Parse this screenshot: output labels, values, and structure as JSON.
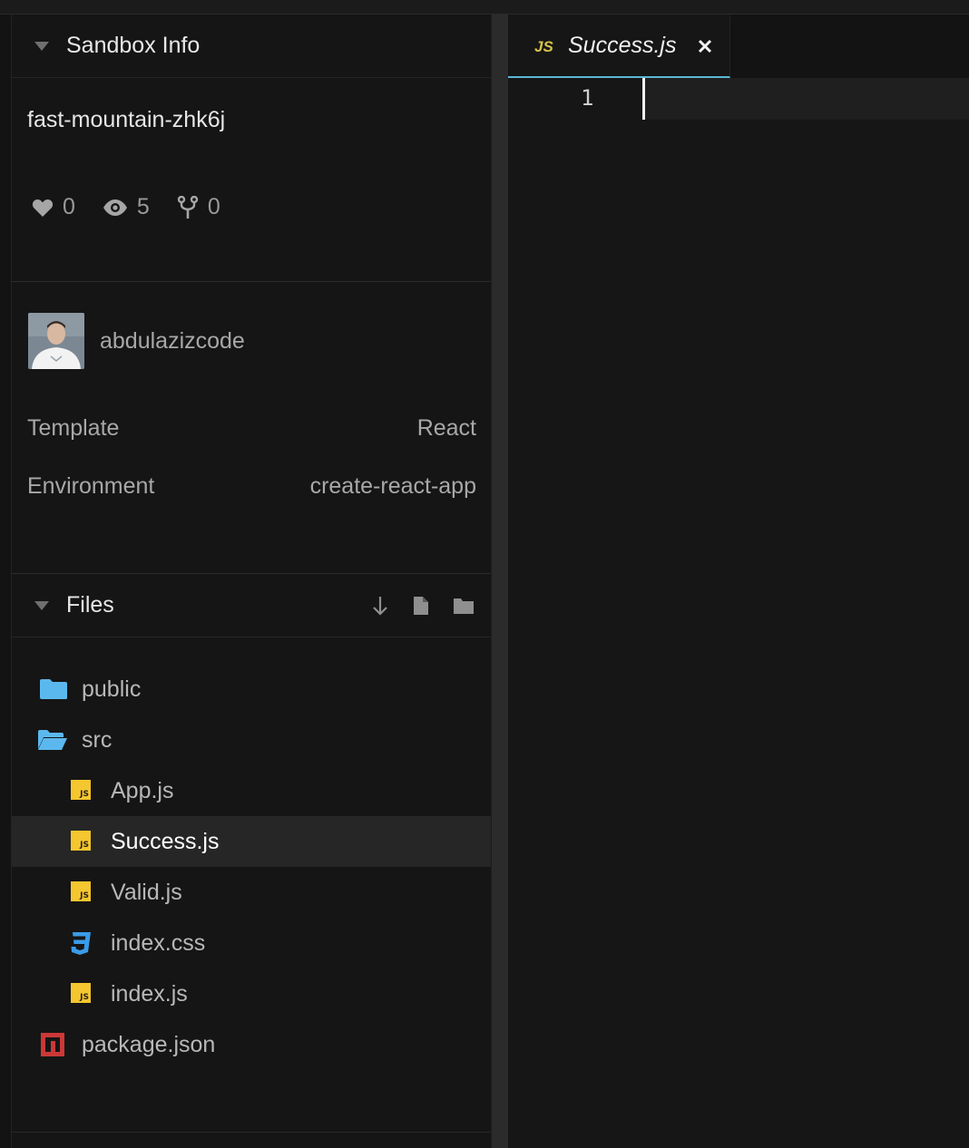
{
  "sidebar": {
    "sandbox_info": {
      "title": "Sandbox Info",
      "name": "fast-mountain-zhk6j",
      "stats": {
        "likes": "0",
        "views": "5",
        "forks": "0"
      },
      "author": "abdulazizcode",
      "template_label": "Template",
      "template_value": "React",
      "environment_label": "Environment",
      "environment_value": "create-react-app"
    },
    "files": {
      "title": "Files",
      "items": [
        {
          "label": "public",
          "icon": "folder-icon"
        },
        {
          "label": "src",
          "icon": "folder-open-icon"
        },
        {
          "label": "App.js",
          "icon": "js-file-icon"
        },
        {
          "label": "Success.js",
          "icon": "js-file-icon"
        },
        {
          "label": "Valid.js",
          "icon": "js-file-icon"
        },
        {
          "label": "index.css",
          "icon": "css-file-icon"
        },
        {
          "label": "index.js",
          "icon": "js-file-icon"
        },
        {
          "label": "package.json",
          "icon": "npm-icon"
        }
      ]
    }
  },
  "editor": {
    "tab": {
      "badge": "JS",
      "title": "Success.js"
    },
    "line_number": "1"
  },
  "colors": {
    "accent": "#5bb8d6",
    "js": "#f4c62f",
    "folder": "#5bb8ee",
    "css": "#3a9be8",
    "npm": "#cb3837"
  }
}
